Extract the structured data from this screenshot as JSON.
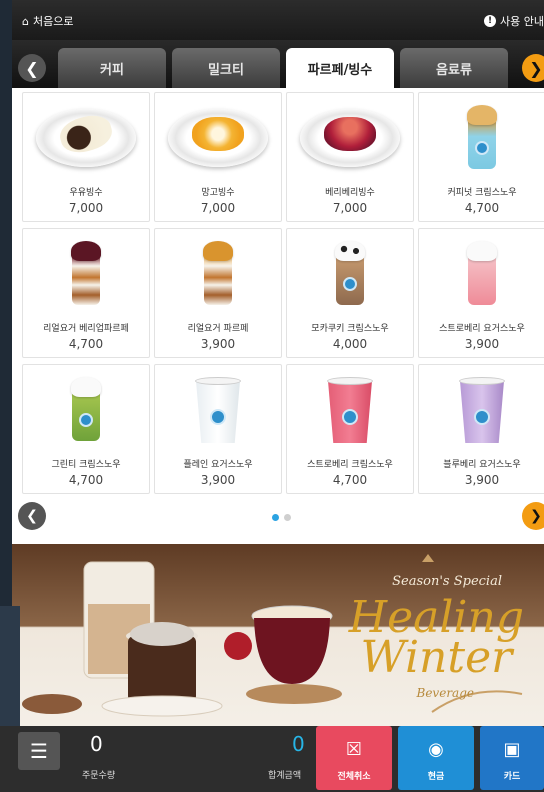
{
  "header": {
    "home_label": "처음으로",
    "help_label": "사용 안내"
  },
  "tabs": [
    {
      "label": "커피",
      "active": false
    },
    {
      "label": "밀크티",
      "active": false
    },
    {
      "label": "파르페/빙수",
      "active": true
    },
    {
      "label": "음료류",
      "active": false
    }
  ],
  "products": [
    {
      "name": "우유빙수",
      "price": "7,000",
      "image": "milk-bingsu"
    },
    {
      "name": "망고빙수",
      "price": "7,000",
      "image": "mango-bingsu"
    },
    {
      "name": "베리베리빙수",
      "price": "7,000",
      "image": "berry-bingsu"
    },
    {
      "name": "커피넛 크림스노우",
      "price": "4,700",
      "image": "coffee-nut-cream-snow"
    },
    {
      "name": "리얼요거 베리업파르페",
      "price": "4,700",
      "image": "yogurt-berry-parfait"
    },
    {
      "name": "리얼요거 파르페",
      "price": "3,900",
      "image": "yogurt-parfait"
    },
    {
      "name": "모카쿠키 크림스노우",
      "price": "4,000",
      "image": "mocha-cookie-cream-snow"
    },
    {
      "name": "스트로베리 요거스노우",
      "price": "3,900",
      "image": "strawberry-yogurt-snow"
    },
    {
      "name": "그린티 크림스노우",
      "price": "4,700",
      "image": "green-tea-cream-snow"
    },
    {
      "name": "플레인 요거스노우",
      "price": "3,900",
      "image": "plain-yogurt-snow"
    },
    {
      "name": "스트로베리 크림스노우",
      "price": "4,700",
      "image": "strawberry-cream-snow"
    },
    {
      "name": "블루베리 요거스노우",
      "price": "3,900",
      "image": "blueberry-yogurt-snow"
    }
  ],
  "pagination": {
    "current_page": 1,
    "total_pages": 2
  },
  "banner": {
    "season_text": "Season's Special",
    "title_line1": "Healing",
    "title_line2": "Winter",
    "subtitle": "Beverage"
  },
  "order": {
    "count_value": "0",
    "count_label": "주문수량",
    "total_value": "0",
    "total_label": "합계금액"
  },
  "actions": {
    "cancel_all": "전체취소",
    "cash": "현금",
    "card": "카드"
  },
  "colors": {
    "accent_orange": "#f39c12",
    "total_blue": "#27b5e6",
    "cancel_red": "#e84a5f",
    "cash_blue": "#1f8fd6",
    "card_blue": "#2176c7"
  }
}
